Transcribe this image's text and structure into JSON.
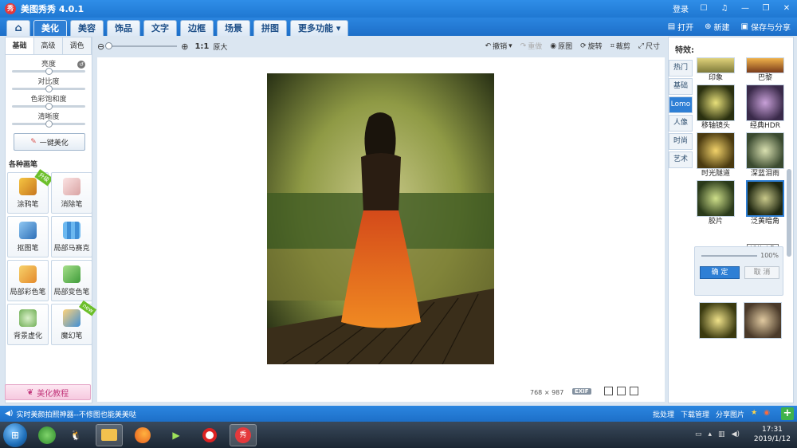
{
  "app": {
    "title": "美图秀秀 4.0.1",
    "logo_text": "秀",
    "login": "登录"
  },
  "window_controls": {
    "icons": [
      "chat-icon",
      "skin-icon",
      "minimize-icon",
      "maximize-icon",
      "close-icon"
    ]
  },
  "menu": {
    "tabs": [
      "美化",
      "美容",
      "饰品",
      "文字",
      "边框",
      "场景",
      "拼图",
      "更多功能 ▾"
    ],
    "active": "美化",
    "open": "打开",
    "new": "新建",
    "save_share": "保存与分享"
  },
  "left_panel": {
    "tabs": [
      "基础",
      "高级",
      "调色"
    ],
    "sliders": [
      {
        "label": "亮度",
        "value": 0.5
      },
      {
        "label": "对比度",
        "value": 0.5
      },
      {
        "label": "色彩饱和度",
        "value": 0.5
      },
      {
        "label": "清晰度",
        "value": 0.5
      }
    ],
    "one_click": "一键美化",
    "brushes_heading": "各种画笔",
    "brushes": [
      {
        "label": "涂鸦笔",
        "badge": "升级"
      },
      {
        "label": "消除笔",
        "badge": ""
      },
      {
        "label": "抠图笔",
        "badge": ""
      },
      {
        "label": "局部马赛克",
        "badge": ""
      },
      {
        "label": "局部彩色笔",
        "badge": ""
      },
      {
        "label": "局部变色笔",
        "badge": ""
      },
      {
        "label": "背景虚化",
        "badge": ""
      },
      {
        "label": "魔幻笔",
        "badge": "new"
      }
    ],
    "tutorial": "美化教程"
  },
  "toolbar": {
    "zoom_value": 0.0,
    "zoom_1to1": "1:1",
    "zoom_fit": "原大",
    "undo": "撤销",
    "redo": "重做",
    "original": "原图",
    "rotate": "旋转",
    "crop": "裁剪",
    "resize": "尺寸"
  },
  "canvas": {
    "width": "768",
    "times": "×",
    "height": "987",
    "exif": "EXIF"
  },
  "right_panel": {
    "title": "特效:",
    "categories": [
      "热门",
      "基础",
      "Lomo",
      "人像",
      "时尚",
      "艺术"
    ],
    "active_category": "Lomo",
    "effects": [
      {
        "label": "印象"
      },
      {
        "label": "巴黎"
      },
      {
        "label": "移轴镜头"
      },
      {
        "label": "经典HDR"
      },
      {
        "label": "时光隧道"
      },
      {
        "label": "深蓝泪雨"
      },
      {
        "label": "胶片"
      },
      {
        "label": "泛黄暗角",
        "selected": true
      }
    ],
    "tooltip": "泛黄暗角",
    "strength": "100%",
    "ok": "确 定",
    "cancel": "取 消"
  },
  "status": {
    "message": "实时美颜拍照神器--不修图也能美美哒",
    "batch": "批处理",
    "download": "下载管理",
    "share": "分享图片"
  },
  "taskbar": {
    "time": "17:31",
    "date": "2019/1/12"
  }
}
